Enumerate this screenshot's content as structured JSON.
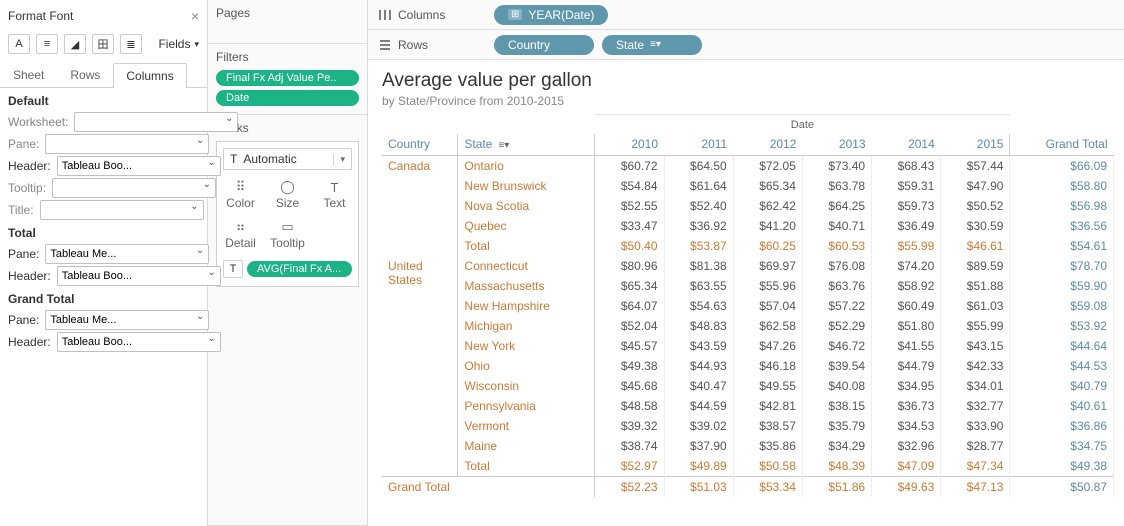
{
  "formatPanel": {
    "title": "Format Font",
    "fieldsLabel": "Fields",
    "tabs": {
      "sheet": "Sheet",
      "rows": "Rows",
      "columns": "Columns"
    },
    "sections": {
      "default": "Default",
      "total": "Total",
      "grandTotal": "Grand Total"
    },
    "labels": {
      "worksheet": "Worksheet:",
      "pane": "Pane:",
      "header": "Header:",
      "tooltip": "Tooltip:",
      "title": "Title:"
    },
    "values": {
      "tableauBoo": "Tableau Boo...",
      "tableauMe": "Tableau Me..."
    }
  },
  "middle": {
    "pages": "Pages",
    "filters": "Filters",
    "marks": "Marks",
    "filterPills": [
      "Final Fx Adj Value Pe..",
      "Date"
    ],
    "automatic": "Automatic",
    "cells": {
      "color": "Color",
      "size": "Size",
      "text": "Text",
      "detail": "Detail",
      "tooltip": "Tooltip"
    },
    "markPill": "AVG(Final Fx A..."
  },
  "shelves": {
    "colsLabel": "Columns",
    "rowsLabel": "Rows",
    "colPill": "YEAR(Date)",
    "rowPill1": "Country",
    "rowPill2": "State"
  },
  "viz": {
    "title": "Average value per gallon",
    "subtitle": "by State/Province from 2010-2015"
  },
  "table": {
    "superHeader": "Date",
    "headers": {
      "country": "Country",
      "state": "State",
      "grandTotal": "Grand Total"
    },
    "years": [
      "2010",
      "2011",
      "2012",
      "2013",
      "2014",
      "2015"
    ],
    "totalLabel": "Total",
    "grandLabel": "Grand Total",
    "groups": [
      {
        "country": "Canada",
        "rows": [
          {
            "state": "Ontario",
            "v": [
              "$60.72",
              "$64.50",
              "$72.05",
              "$73.40",
              "$68.43",
              "$57.44"
            ],
            "gt": "$66.09"
          },
          {
            "state": "New Brunswick",
            "v": [
              "$54.84",
              "$61.64",
              "$65.34",
              "$63.78",
              "$59.31",
              "$47.90"
            ],
            "gt": "$58.80"
          },
          {
            "state": "Nova Scotia",
            "v": [
              "$52.55",
              "$52.40",
              "$62.42",
              "$64.25",
              "$59.73",
              "$50.52"
            ],
            "gt": "$56.98"
          },
          {
            "state": "Quebec",
            "v": [
              "$33.47",
              "$36.92",
              "$41.20",
              "$40.71",
              "$36.49",
              "$30.59"
            ],
            "gt": "$36.56"
          }
        ],
        "total": {
          "v": [
            "$50.40",
            "$53.87",
            "$60.25",
            "$60.53",
            "$55.99",
            "$46.61"
          ],
          "gt": "$54.61"
        }
      },
      {
        "country": "United States",
        "rows": [
          {
            "state": "Connecticut",
            "v": [
              "$80.96",
              "$81.38",
              "$69.97",
              "$76.08",
              "$74.20",
              "$89.59"
            ],
            "gt": "$78.70"
          },
          {
            "state": "Massachusetts",
            "v": [
              "$65.34",
              "$63.55",
              "$55.96",
              "$63.76",
              "$58.92",
              "$51.88"
            ],
            "gt": "$59.90"
          },
          {
            "state": "New Hampshire",
            "v": [
              "$64.07",
              "$54.63",
              "$57.04",
              "$57.22",
              "$60.49",
              "$61.03"
            ],
            "gt": "$59.08"
          },
          {
            "state": "Michigan",
            "v": [
              "$52.04",
              "$48.83",
              "$62.58",
              "$52.29",
              "$51.80",
              "$55.99"
            ],
            "gt": "$53.92"
          },
          {
            "state": "New York",
            "v": [
              "$45.57",
              "$43.59",
              "$47.26",
              "$46.72",
              "$41.55",
              "$43.15"
            ],
            "gt": "$44.64"
          },
          {
            "state": "Ohio",
            "v": [
              "$49.38",
              "$44.93",
              "$46.18",
              "$39.54",
              "$44.79",
              "$42.33"
            ],
            "gt": "$44.53"
          },
          {
            "state": "Wisconsin",
            "v": [
              "$45.68",
              "$40.47",
              "$49.55",
              "$40.08",
              "$34.95",
              "$34.01"
            ],
            "gt": "$40.79"
          },
          {
            "state": "Pennsylvania",
            "v": [
              "$48.58",
              "$44.59",
              "$42.81",
              "$38.15",
              "$36.73",
              "$32.77"
            ],
            "gt": "$40.61"
          },
          {
            "state": "Vermont",
            "v": [
              "$39.32",
              "$39.02",
              "$38.57",
              "$35.79",
              "$34.53",
              "$33.90"
            ],
            "gt": "$36.86"
          },
          {
            "state": "Maine",
            "v": [
              "$38.74",
              "$37.90",
              "$35.86",
              "$34.29",
              "$32.96",
              "$28.77"
            ],
            "gt": "$34.75"
          }
        ],
        "total": {
          "v": [
            "$52.97",
            "$49.89",
            "$50.58",
            "$48.39",
            "$47.09",
            "$47.34"
          ],
          "gt": "$49.38"
        }
      }
    ],
    "grandTotal": {
      "v": [
        "$52.23",
        "$51.03",
        "$53.34",
        "$51.86",
        "$49.63",
        "$47.13"
      ],
      "gt": "$50.87"
    }
  }
}
